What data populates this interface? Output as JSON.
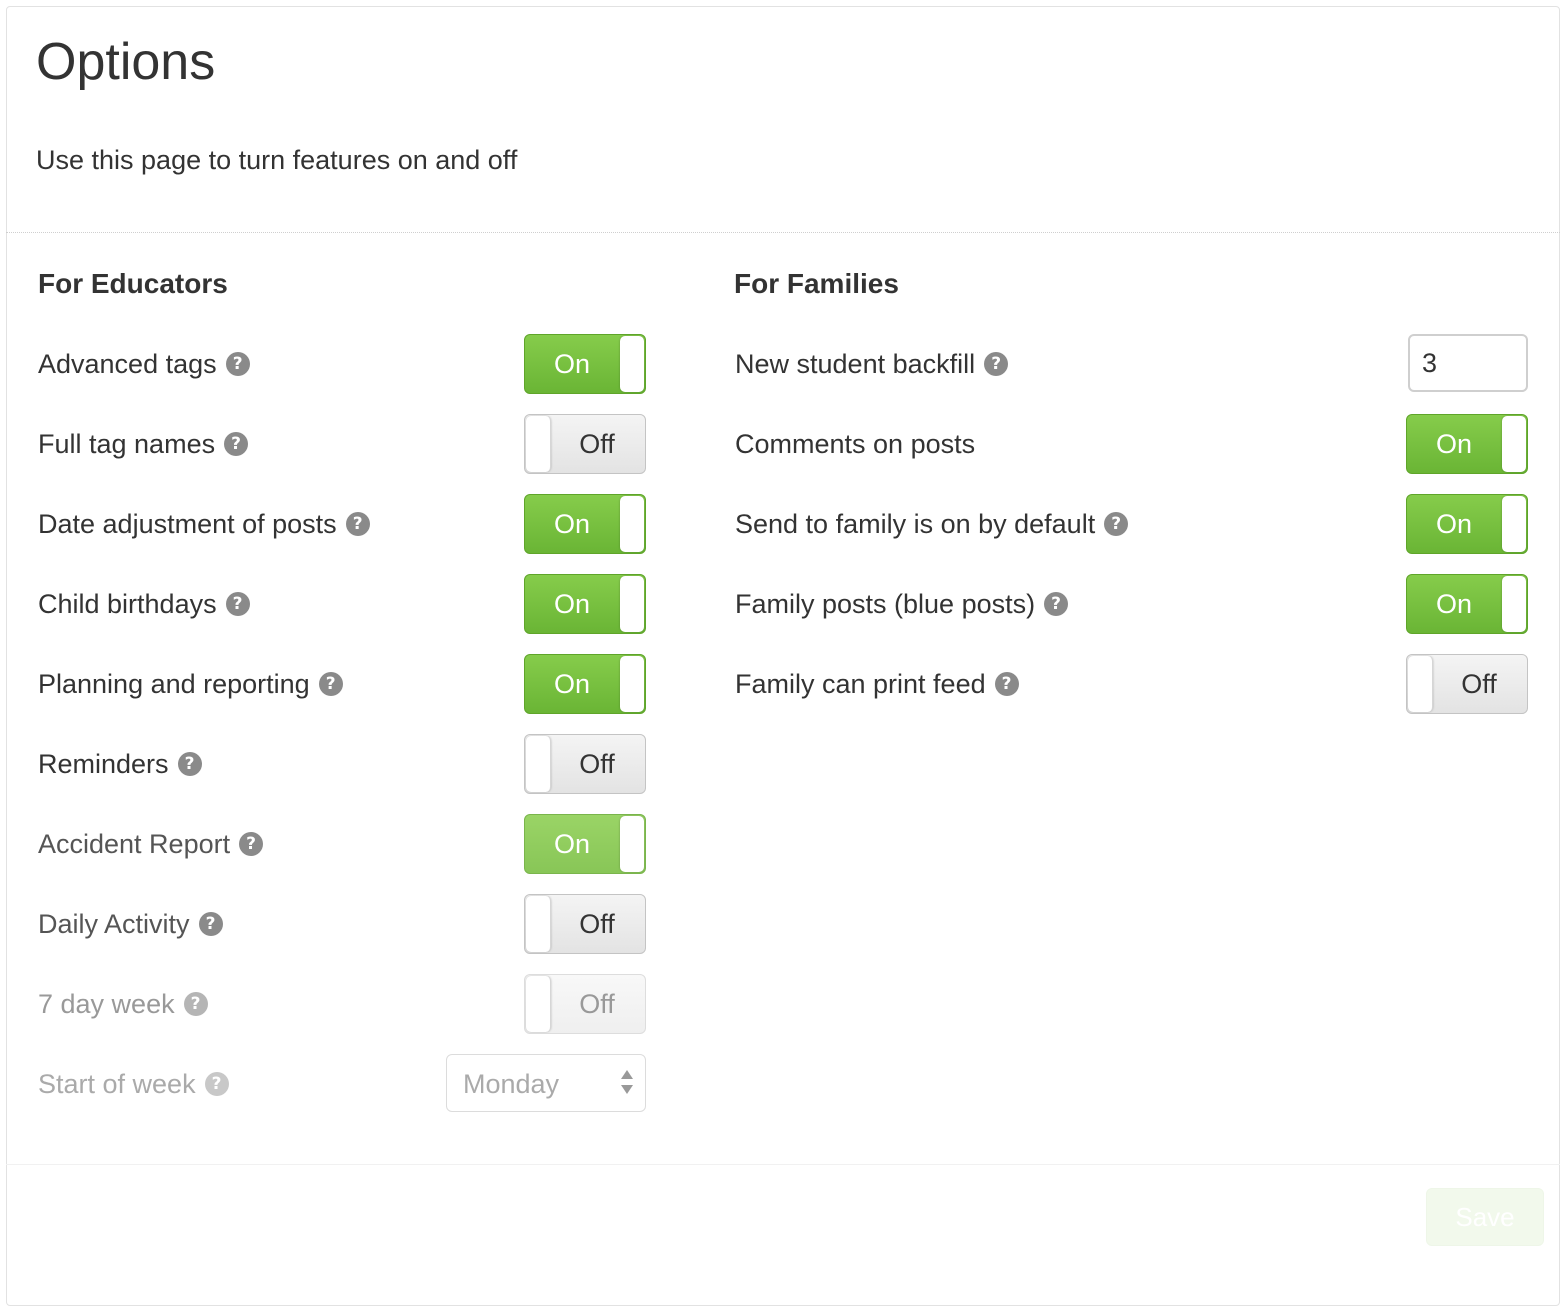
{
  "page": {
    "title": "Options",
    "subtitle": "Use this page to turn features on and off"
  },
  "educators": {
    "heading": "For Educators",
    "rows": [
      {
        "label": "Advanced tags",
        "state": "On"
      },
      {
        "label": "Full tag names",
        "state": "Off"
      },
      {
        "label": "Date adjustment of posts",
        "state": "On"
      },
      {
        "label": "Child birthdays",
        "state": "On"
      },
      {
        "label": "Planning and reporting",
        "state": "On"
      },
      {
        "label": "Reminders",
        "state": "Off"
      },
      {
        "label": "Accident Report",
        "state": "On"
      },
      {
        "label": "Daily Activity",
        "state": "Off"
      },
      {
        "label": "7 day week",
        "state": "Off"
      }
    ],
    "start_of_week": {
      "label": "Start of week",
      "value": "Monday"
    }
  },
  "families": {
    "heading": "For Families",
    "backfill": {
      "label": "New student backfill",
      "value": "3"
    },
    "rows": [
      {
        "label": "Comments on posts",
        "state": "On"
      },
      {
        "label": "Send to family is on by default",
        "state": "On"
      },
      {
        "label": "Family posts (blue posts)",
        "state": "On"
      },
      {
        "label": "Family can print feed",
        "state": "Off"
      }
    ]
  },
  "footer": {
    "save_label": "Save"
  },
  "icons": {
    "help": "question-circle-icon",
    "select_arrows": "up-down-arrows-icon"
  },
  "colors": {
    "toggle_on": "#7cc242",
    "toggle_off": "#e8e8e8",
    "text": "#333333",
    "muted_text": "#999999"
  }
}
